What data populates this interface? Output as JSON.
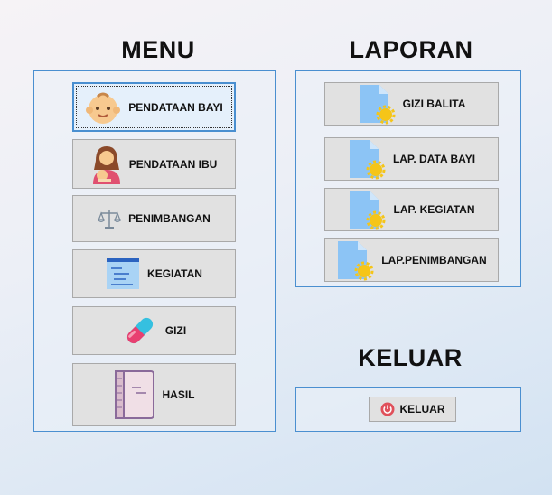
{
  "menu": {
    "title": "MENU",
    "buttons": [
      {
        "label": "PENDATAAN BAYI",
        "icon": "baby-face-icon"
      },
      {
        "label": "PENDATAAN IBU",
        "icon": "mother-icon"
      },
      {
        "label": "PENIMBANGAN",
        "icon": "scale-icon"
      },
      {
        "label": "KEGIATAN",
        "icon": "text-document-icon"
      },
      {
        "label": "GIZI",
        "icon": "pill-capsule-icon"
      },
      {
        "label": "HASIL",
        "icon": "notebook-icon"
      }
    ]
  },
  "laporan": {
    "title": "LAPORAN",
    "buttons": [
      {
        "label": "GIZI BALITA",
        "icon": "report-file-icon"
      },
      {
        "label": "LAP. DATA BAYI",
        "icon": "report-file-icon"
      },
      {
        "label": "LAP. KEGIATAN",
        "icon": "report-file-icon"
      },
      {
        "label": "LAP.PENIMBANGAN",
        "icon": "report-file-icon"
      }
    ]
  },
  "keluar": {
    "title": "KELUAR",
    "button_label": "KELUAR",
    "button_icon": "power-icon"
  },
  "colors": {
    "panel_border": "#4a8fd0",
    "button_bg": "#e1e1e1",
    "file_blue": "#8cc4f5",
    "gear_yellow": "#f5c518",
    "power_red": "#e0505a"
  }
}
